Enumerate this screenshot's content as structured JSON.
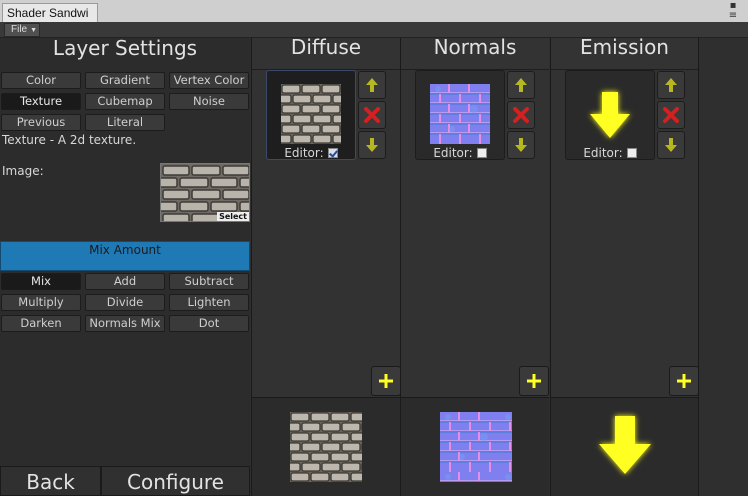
{
  "window": {
    "tab_title": "Shader Sandwi",
    "controls_icon": "window-menu-icon"
  },
  "menubar": {
    "file_label": "File"
  },
  "left_panel": {
    "title": "Layer Settings",
    "type_buttons": [
      "Color",
      "Gradient",
      "Vertex Color",
      "Texture",
      "Cubemap",
      "Noise",
      "Previous",
      "Literal"
    ],
    "selected_type": "Texture",
    "description": "Texture - A 2d texture.",
    "image_label": "Image:",
    "select_label": "Select",
    "mix_amount_label": "Mix Amount",
    "mix_buttons": [
      "Mix",
      "Add",
      "Subtract",
      "Multiply",
      "Divide",
      "Lighten",
      "Darken",
      "Normals Mix",
      "Dot"
    ],
    "selected_mix": "Mix",
    "back_label": "Back",
    "configure_label": "Configure"
  },
  "columns": [
    {
      "title": "Diffuse",
      "editor_label": "Editor:",
      "editor_checked": true,
      "thumb": "brick-texture"
    },
    {
      "title": "Normals",
      "editor_label": "Editor:",
      "editor_checked": false,
      "thumb": "normal-map"
    },
    {
      "title": "Emission",
      "editor_label": "Editor:",
      "editor_checked": false,
      "thumb": "yellow-arrow"
    }
  ],
  "colors": {
    "mix_bar": "#1f79b5",
    "accent_yellow": "#ffff22",
    "delete_red": "#d42020",
    "arrow_olive": "#b7b720"
  }
}
